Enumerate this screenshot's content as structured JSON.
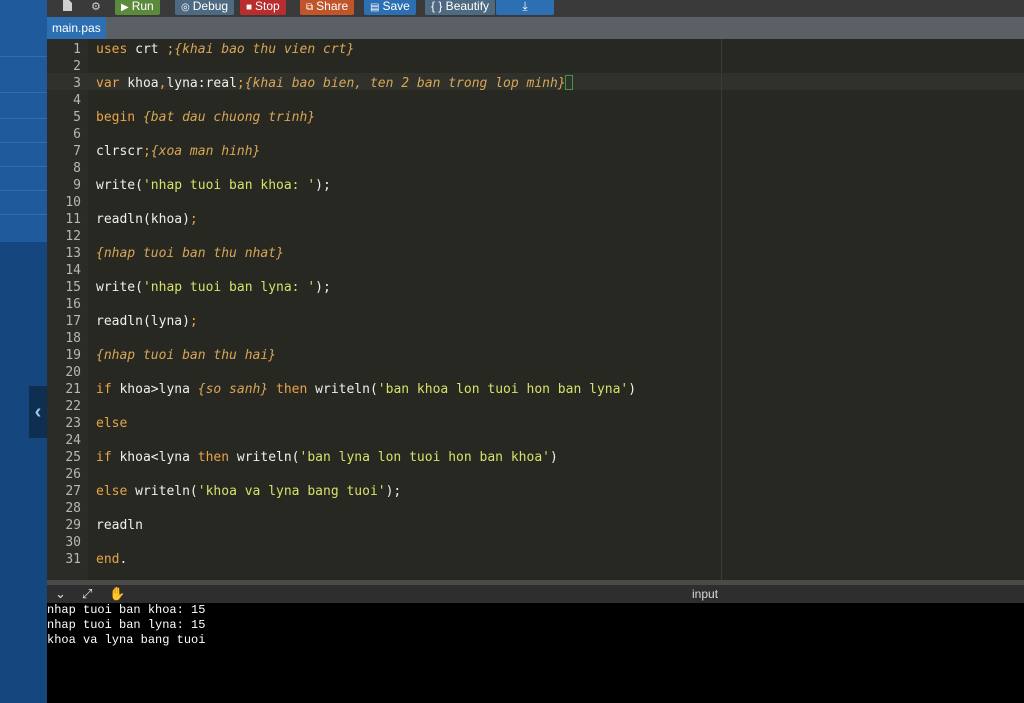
{
  "toolbar": {
    "run_label": "Run",
    "debug_label": "Debug",
    "stop_label": "Stop",
    "share_label": "Share",
    "save_label": "Save",
    "beautify_label": "{ } Beautify",
    "colors": {
      "run": "#5b8a3c",
      "debug": "#4e6a82",
      "stop": "#b82d2d",
      "share": "#c0552a",
      "save": "#2d6fb3",
      "beautify": "#4e6a82",
      "download": "#2d6fb3"
    }
  },
  "file_tab": {
    "name": "main.pas"
  },
  "code_lines": [
    {
      "n": "1",
      "segs": [
        [
          "kw",
          "uses"
        ],
        [
          "pn",
          " crt "
        ],
        [
          "kw",
          ";"
        ],
        [
          "cm",
          "{khai bao thu vien crt}"
        ]
      ]
    },
    {
      "n": "2",
      "segs": []
    },
    {
      "n": "3",
      "segs": [
        [
          "kw",
          "var"
        ],
        [
          "pn",
          " khoa"
        ],
        [
          "kw",
          ","
        ],
        [
          "pn",
          "lyna:real"
        ],
        [
          "kw",
          ";"
        ],
        [
          "cm",
          "{khai bao bien, ten 2 ban trong lop minh}"
        ]
      ]
    },
    {
      "n": "4",
      "segs": []
    },
    {
      "n": "5",
      "segs": [
        [
          "kw",
          "begin"
        ],
        [
          "pn",
          " "
        ],
        [
          "cm",
          "{bat dau chuong trinh}"
        ]
      ]
    },
    {
      "n": "6",
      "segs": []
    },
    {
      "n": "7",
      "segs": [
        [
          "pn",
          "clrscr"
        ],
        [
          "kw",
          ";"
        ],
        [
          "cm",
          "{xoa man hinh}"
        ]
      ]
    },
    {
      "n": "8",
      "segs": []
    },
    {
      "n": "9",
      "segs": [
        [
          "pn",
          "write("
        ],
        [
          "str",
          "'nhap tuoi ban khoa: '"
        ],
        [
          "pn",
          ");"
        ]
      ]
    },
    {
      "n": "10",
      "segs": []
    },
    {
      "n": "11",
      "segs": [
        [
          "pn",
          "readln(khoa)"
        ],
        [
          "kw",
          ";"
        ]
      ]
    },
    {
      "n": "12",
      "segs": []
    },
    {
      "n": "13",
      "segs": [
        [
          "cm",
          "{nhap tuoi ban thu nhat}"
        ]
      ]
    },
    {
      "n": "14",
      "segs": []
    },
    {
      "n": "15",
      "segs": [
        [
          "pn",
          "write("
        ],
        [
          "str",
          "'nhap tuoi ban lyna: '"
        ],
        [
          "pn",
          ");"
        ]
      ]
    },
    {
      "n": "16",
      "segs": []
    },
    {
      "n": "17",
      "segs": [
        [
          "pn",
          "readln(lyna)"
        ],
        [
          "kw",
          ";"
        ]
      ]
    },
    {
      "n": "18",
      "segs": []
    },
    {
      "n": "19",
      "segs": [
        [
          "cm",
          "{nhap tuoi ban thu hai}"
        ]
      ]
    },
    {
      "n": "20",
      "segs": []
    },
    {
      "n": "21",
      "segs": [
        [
          "kw",
          "if"
        ],
        [
          "pn",
          " khoa>lyna "
        ],
        [
          "cm",
          "{so sanh}"
        ],
        [
          "pn",
          " "
        ],
        [
          "kw",
          "then"
        ],
        [
          "pn",
          " writeln("
        ],
        [
          "str",
          "'ban khoa lon tuoi hon ban lyna'"
        ],
        [
          "pn",
          ")"
        ]
      ]
    },
    {
      "n": "22",
      "segs": []
    },
    {
      "n": "23",
      "segs": [
        [
          "kw",
          "else"
        ]
      ]
    },
    {
      "n": "24",
      "segs": []
    },
    {
      "n": "25",
      "segs": [
        [
          "kw",
          "if"
        ],
        [
          "pn",
          " khoa<lyna "
        ],
        [
          "kw",
          "then"
        ],
        [
          "pn",
          " writeln("
        ],
        [
          "str",
          "'ban lyna lon tuoi hon ban khoa'"
        ],
        [
          "pn",
          ")"
        ]
      ]
    },
    {
      "n": "26",
      "segs": []
    },
    {
      "n": "27",
      "segs": [
        [
          "kw",
          "else"
        ],
        [
          "pn",
          " writeln("
        ],
        [
          "str",
          "'khoa va lyna bang tuoi'"
        ],
        [
          "pn",
          ");"
        ]
      ]
    },
    {
      "n": "28",
      "segs": []
    },
    {
      "n": "29",
      "segs": [
        [
          "pn",
          "readln"
        ]
      ]
    },
    {
      "n": "30",
      "segs": []
    },
    {
      "n": "31",
      "segs": [
        [
          "kw",
          "end"
        ],
        [
          "pn",
          "."
        ]
      ]
    }
  ],
  "output": {
    "title": "input",
    "console_lines": [
      "nhap tuoi ban khoa: 15",
      "nhap tuoi ban lyna: 15",
      "khoa va lyna bang tuoi"
    ]
  },
  "icons": [
    "file-icon",
    "gear-icon",
    "play-icon",
    "debug-icon",
    "stop-icon",
    "share-icon",
    "save-icon",
    "download-icon",
    "chevron-left-icon",
    "chevron-down-icon",
    "expand-icon",
    "hand-icon"
  ]
}
